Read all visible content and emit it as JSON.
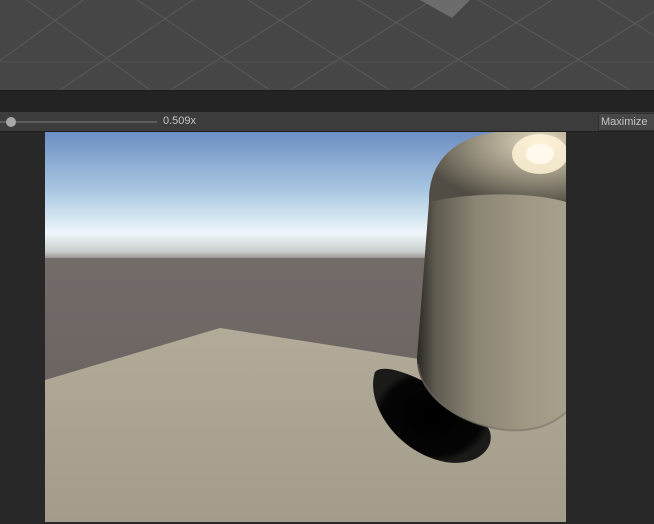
{
  "scene_view": {
    "grid": true
  },
  "game_toolbar": {
    "scale_value": "0.509x",
    "maximize_label": "Maximize"
  },
  "game_view": {
    "objects": [
      "skybox",
      "ground",
      "plane",
      "capsule",
      "shadow"
    ]
  },
  "colors": {
    "editor_bg": "#282828",
    "toolbar_bg": "#3c3c3c",
    "sky_top": "#6d8fc1",
    "horizon": "#eef7fb",
    "ground": "#6b6462",
    "plane": "#a9a18f",
    "capsule": "#a09a86"
  }
}
